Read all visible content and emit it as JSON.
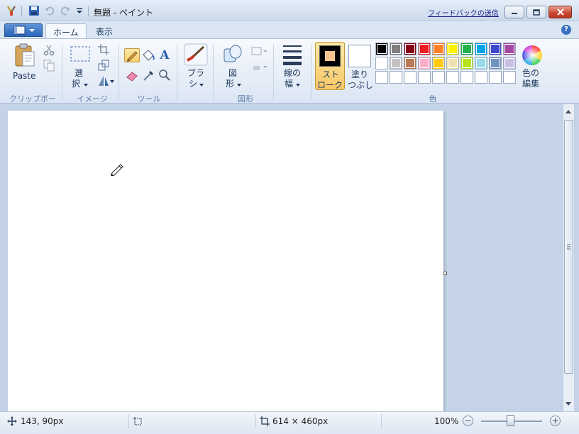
{
  "window": {
    "title": "無題 - ペイント",
    "feedback_link": "フィードバックの送信"
  },
  "tabs": [
    {
      "label": "ホーム",
      "active": true
    },
    {
      "label": "表示",
      "active": false
    }
  ],
  "ribbon": {
    "clipboard": {
      "paste_label": "Paste",
      "group_label": "クリップボード"
    },
    "image": {
      "select_label_1": "選",
      "select_label_2": "択",
      "group_label": "イメージ"
    },
    "tools": {
      "group_label": "ツール",
      "text_glyph": "A"
    },
    "brushes": {
      "label_1": "ブラ",
      "label_2": "シ"
    },
    "shapes": {
      "label_1": "図",
      "label_2": "形",
      "group_label": "図形"
    },
    "size": {
      "label_1": "線の",
      "label_2": "幅"
    },
    "stroke": {
      "label_1": "スト",
      "label_2": "ローク"
    },
    "fill": {
      "label_1": "塗り",
      "label_2": "つぶし"
    },
    "colors": {
      "group_label": "色",
      "edit_label_1": "色の",
      "edit_label_2": "編集",
      "row1": [
        "#000000",
        "#7f7f7f",
        "#880015",
        "#ed1c24",
        "#ff7f27",
        "#fff200",
        "#22b14c",
        "#00a2e8",
        "#3f48cc",
        "#a349a4"
      ],
      "row2": [
        "#ffffff",
        "#c3c3c3",
        "#b97a57",
        "#ffaec9",
        "#ffc90e",
        "#efe4b0",
        "#b5e61d",
        "#99d9ea",
        "#7092be",
        "#c8bfe7"
      ],
      "row3": [
        "#ffffff",
        "#ffffff",
        "#ffffff",
        "#ffffff",
        "#ffffff",
        "#ffffff",
        "#ffffff",
        "#ffffff",
        "#ffffff",
        "#ffffff"
      ],
      "stroke_color": "#000000",
      "stroke_inner": "#f9c38f",
      "fill_color": "#ffffff"
    }
  },
  "status": {
    "cursor_pos": "143, 90px",
    "canvas_size": "614 × 460px",
    "zoom": "100%",
    "zoom_minus": "−",
    "zoom_plus": "+"
  }
}
